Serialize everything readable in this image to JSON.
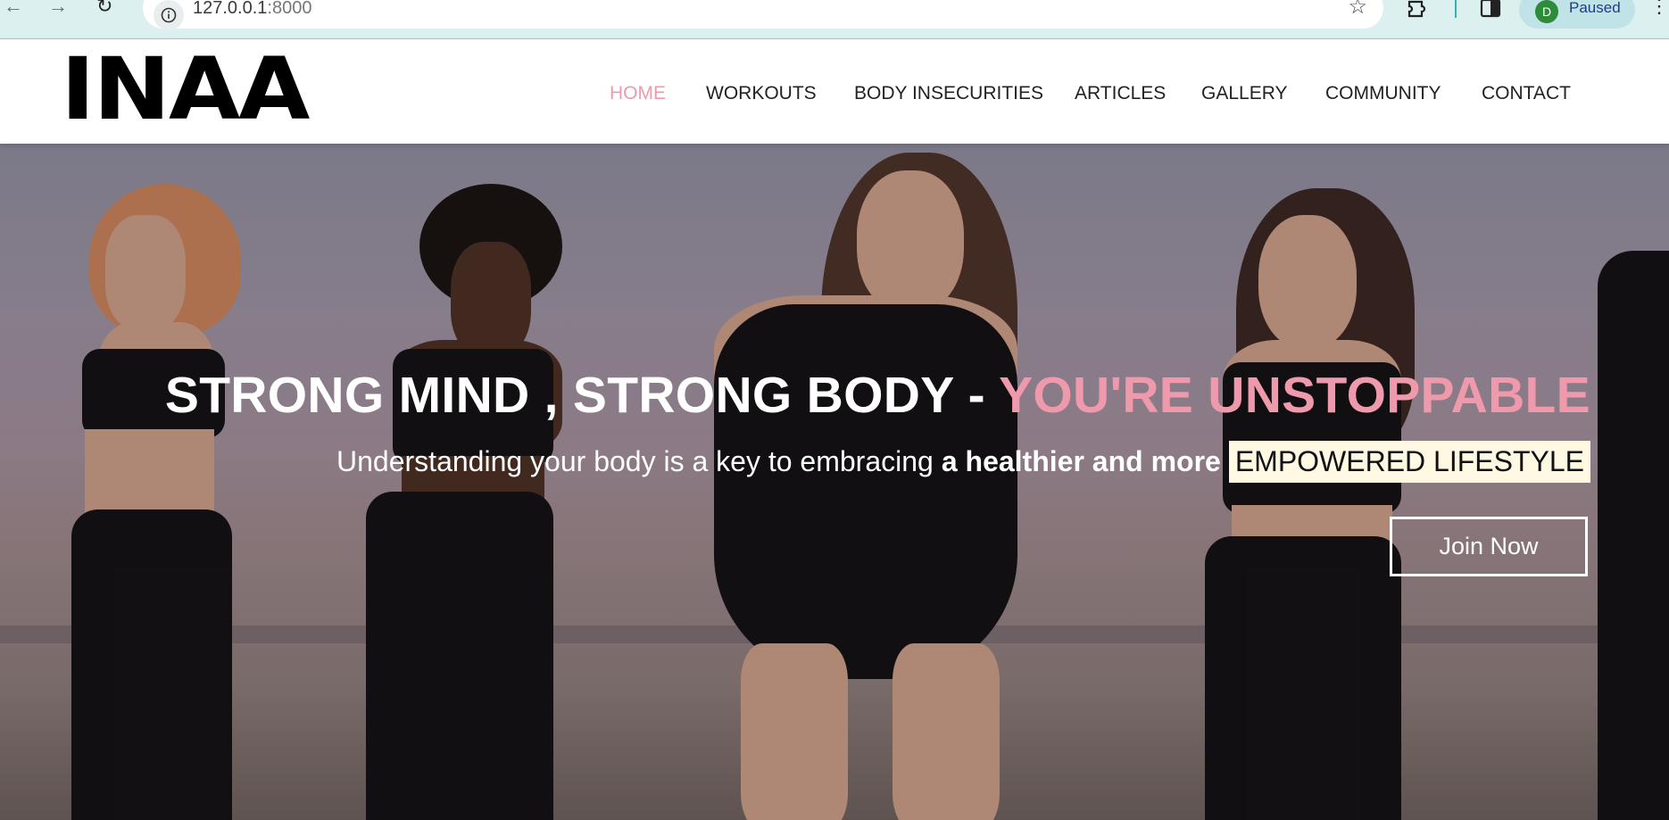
{
  "browser": {
    "url_host": "127.0.0.1",
    "url_port": ":8000",
    "profile_initial": "D",
    "profile_status": "Paused"
  },
  "site": {
    "logo": "INAA",
    "nav": [
      {
        "label": "HOME",
        "active": true
      },
      {
        "label": "WORKOUTS"
      },
      {
        "label": "BODY INSECURITIES"
      },
      {
        "label": "ARTICLES"
      },
      {
        "label": "GALLERY"
      },
      {
        "label": "COMMUNITY"
      },
      {
        "label": "CONTACT"
      }
    ]
  },
  "hero": {
    "title_main": "STRONG MIND , STRONG BODY - ",
    "title_accent": "YOU'RE UNSTOPPABLE",
    "subtitle_plain": "Understanding your body is a key to embracing",
    "subtitle_bold": "a healthier and more",
    "subtitle_highlight": "EMPOWERED LIFESTYLE",
    "cta_label": "Join Now"
  },
  "colors": {
    "accent": "#ee9aac",
    "highlight_bg": "#fff8e2"
  }
}
